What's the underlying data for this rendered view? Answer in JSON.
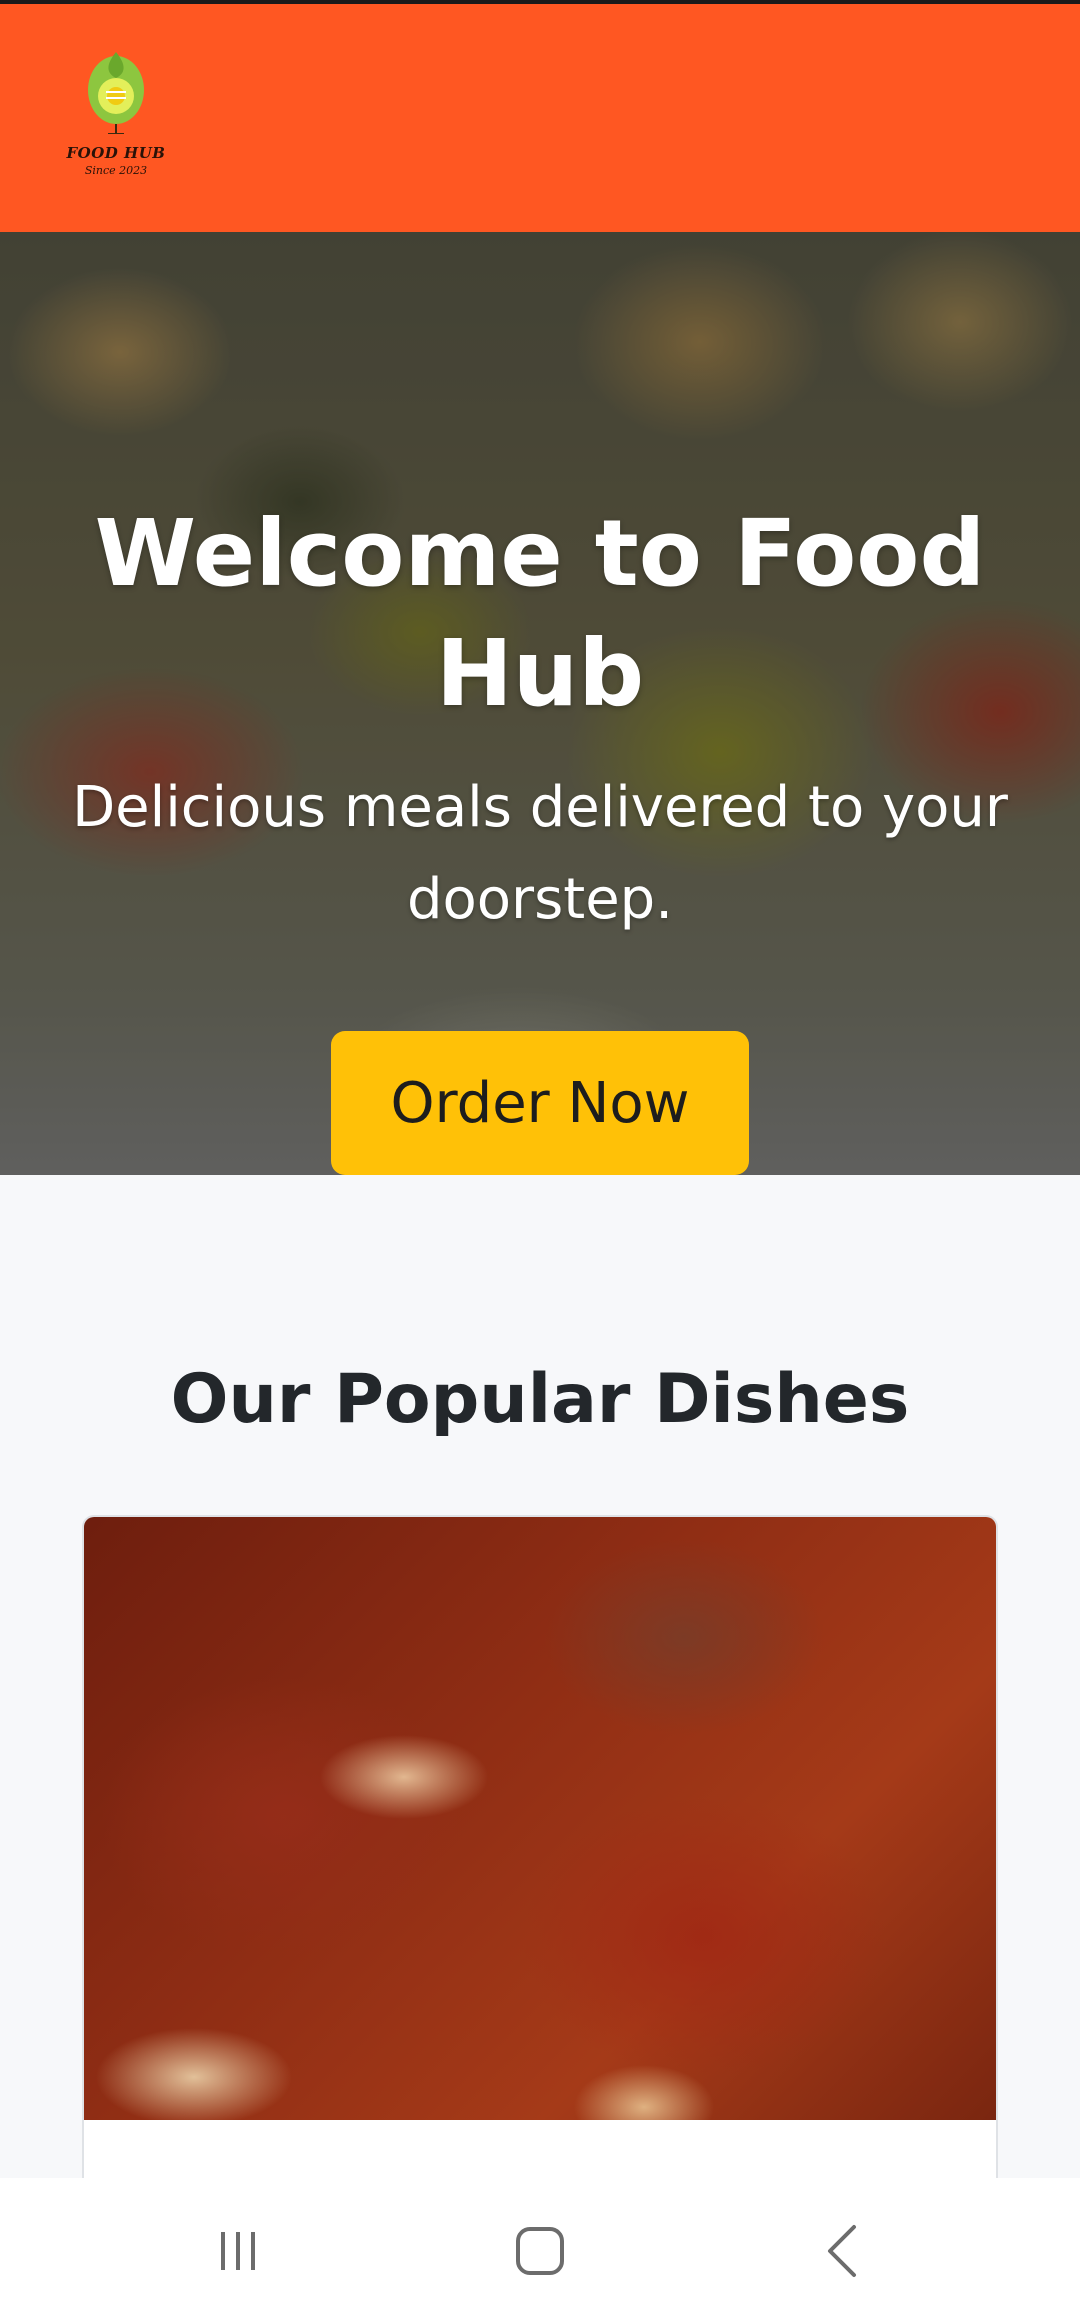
{
  "brand": {
    "logo_title": "FOOD HUB",
    "logo_subtitle": "Since 2023",
    "header_color": "#ff5722"
  },
  "hero": {
    "title": "Welcome to Food Hub",
    "subtitle": "Delicious meals delivered to your doorstep.",
    "cta_label": "Order Now",
    "cta_color": "#ffc107"
  },
  "popular": {
    "section_title": "Our Popular Dishes",
    "dishes": [
      {
        "name": "",
        "image_icon": "ribs-image"
      }
    ]
  },
  "navbar": {
    "recents_icon": "recents-icon",
    "home_icon": "home-icon",
    "back_icon": "back-icon"
  }
}
